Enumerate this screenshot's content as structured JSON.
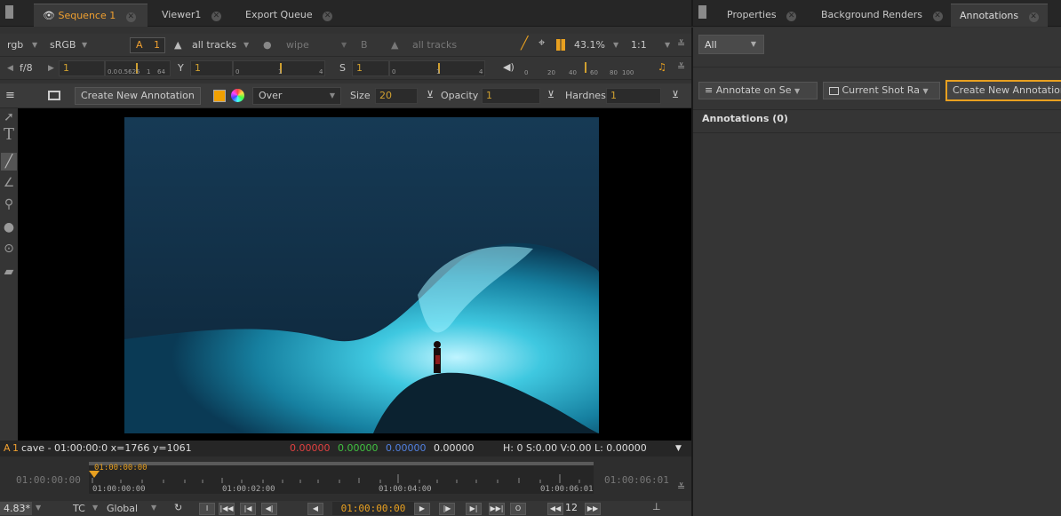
{
  "left_tabs": [
    {
      "label": "Sequence 1",
      "active": true
    },
    {
      "label": "Viewer1",
      "active": false
    },
    {
      "label": "Export Queue",
      "active": false
    }
  ],
  "right_tabs": [
    {
      "label": "Properties",
      "active": false
    },
    {
      "label": "Background Renders",
      "active": false
    },
    {
      "label": "Annotations",
      "active": true
    }
  ],
  "viewer_toolbar1": {
    "channels": "rgb",
    "lut": "sRGB",
    "input_a": "A",
    "input_a_num": "1",
    "tracks_a": "all tracks",
    "wipe": "wipe",
    "input_b": "B",
    "tracks_b": "all tracks",
    "zoom": "43.1%",
    "ratio": "1:1"
  },
  "viewer_toolbar2": {
    "fstop": "f/8",
    "gain_value": "1",
    "gain_ticks": [
      "0.0",
      "0.5625",
      "1",
      "64"
    ],
    "gamma_label": "Y",
    "gamma_value": "1",
    "gamma_ticks": [
      "0",
      "1",
      "4"
    ],
    "sat_label": "S",
    "sat_value": "1",
    "sat_ticks": [
      "0",
      "1",
      "4"
    ],
    "audio_ticks": [
      "0",
      "20",
      "40",
      "60",
      "80",
      "100"
    ]
  },
  "annotation_toolbar": {
    "create_label": "Create New Annotation",
    "blend_mode": "Over",
    "size_label": "Size",
    "size_value": "20",
    "opacity_label": "Opacity",
    "opacity_value": "1",
    "hardness_label": "Hardness",
    "hardness_value": "1"
  },
  "status_bar": {
    "input": "A",
    "input_num": "1",
    "info": "cave - 01:00:00:0  x=1766 y=1061",
    "r": "0.00000",
    "g": "0.00000",
    "b": "0.00000",
    "a": "0.00000",
    "hsv": "H:  0 S:0.00 V:0.00  L: 0.00000"
  },
  "timeline": {
    "start": "01:00:00:00",
    "end": "01:00:06:01",
    "playhead": "01:00:00:00",
    "ticks": [
      "01:00:00:00",
      "01:00:02:00",
      "01:00:04:00",
      "01:00:06:01"
    ]
  },
  "transport": {
    "fps": "4.83*",
    "timecode_mode": "TC",
    "scope": "Global",
    "in": "I",
    "current": "01:00:00:00",
    "out": "O",
    "step": "12"
  },
  "annotations_panel": {
    "filter": "All",
    "annotate_on": "Annotate on Se",
    "shot_range": "Current Shot Ra",
    "create_label": "Create New Annotation",
    "heading": "Annotations (0)"
  },
  "colors": {
    "accent": "#f0a030",
    "panel": "#323232",
    "highlight": "#e8a020"
  }
}
